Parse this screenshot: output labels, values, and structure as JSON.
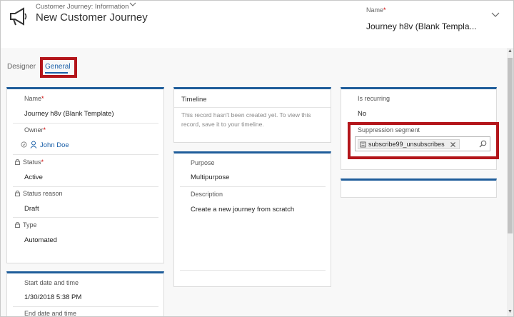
{
  "header": {
    "form_switcher": "Customer Journey: Information",
    "record_title": "New Customer Journey",
    "name_label": "Name",
    "required_marker": "*",
    "name_value": "Journey h8v (Blank Templa..."
  },
  "tabs": [
    {
      "label": "Designer"
    },
    {
      "label": "General"
    }
  ],
  "general_card": {
    "name_label": "Name",
    "name_value": "Journey h8v (Blank Template)",
    "owner_label": "Owner",
    "owner_value": "John Doe",
    "status_label": "Status",
    "status_value": "Active",
    "status_reason_label": "Status reason",
    "status_reason_value": "Draft",
    "type_label": "Type",
    "type_value": "Automated"
  },
  "schedule_card": {
    "start_label": "Start date and time",
    "start_value": "1/30/2018 5:38 PM",
    "end_label": "End date and time"
  },
  "timeline_card": {
    "title": "Timeline",
    "message": "This record hasn't been created yet.  To view this record, save it to your timeline."
  },
  "purpose_card": {
    "purpose_label": "Purpose",
    "purpose_value": "Multipurpose",
    "description_label": "Description",
    "description_value": "Create a new journey from scratch"
  },
  "recurring_card": {
    "recurring_label": "Is recurring",
    "recurring_value": "No",
    "suppression_label": "Suppression segment",
    "suppression_value": "subscribe99_unsubscribes"
  },
  "icons": [
    "megaphone-icon",
    "chevron-down-icon",
    "lock-icon",
    "presence-icon",
    "person-icon",
    "segment-icon",
    "close-icon",
    "search-icon"
  ],
  "colors": {
    "accent": "#1f5d9a",
    "link": "#1a5fa8",
    "highlight": "#b3151a",
    "required": "#cc0000"
  }
}
